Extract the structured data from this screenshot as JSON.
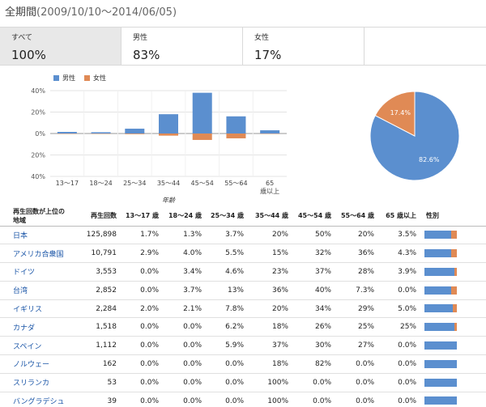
{
  "header": {
    "period_label": "全期間",
    "period_range": "(2009/10/10～2014/06/05)"
  },
  "tabs": [
    {
      "label": "すべて",
      "value": "100%"
    },
    {
      "label": "男性",
      "value": "83%"
    },
    {
      "label": "女性",
      "value": "17%"
    }
  ],
  "colors": {
    "male": "#5b8fcf",
    "female": "#e08a55",
    "tab_active_bg": "#e8e8e8",
    "link": "#1a55a7"
  },
  "chart_data": [
    {
      "type": "bar",
      "title": "",
      "legend": [
        {
          "name": "男性",
          "color": "#5b8fcf"
        },
        {
          "name": "女性",
          "color": "#e08a55"
        }
      ],
      "legend_position": "top-left",
      "xlabel": "年齢",
      "ylabel": "",
      "categories": [
        "13～17",
        "18～24",
        "25～34",
        "35～44",
        "45～54",
        "55～64",
        "65歳以上"
      ],
      "category_lines": [
        [
          "13～17"
        ],
        [
          "18～24"
        ],
        [
          "25～34"
        ],
        [
          "35～44"
        ],
        [
          "45～54"
        ],
        [
          "55～64"
        ],
        [
          "65",
          "歳以上"
        ]
      ],
      "yticks": [
        "40%",
        "20%",
        "0%",
        "20%",
        "40%"
      ],
      "ylim": [
        -40,
        40
      ],
      "grid": true,
      "series": [
        {
          "name": "男性",
          "direction": "up",
          "values": [
            1.5,
            1.2,
            4.5,
            18,
            38,
            16,
            3
          ]
        },
        {
          "name": "女性",
          "direction": "down",
          "values": [
            0.2,
            0.2,
            0.6,
            2,
            6,
            4.5,
            0.3
          ]
        }
      ]
    },
    {
      "type": "pie",
      "title": "",
      "slices": [
        {
          "name": "男性",
          "value": 82.6,
          "label": "82.6%",
          "color": "#5b8fcf"
        },
        {
          "name": "女性",
          "value": 17.4,
          "label": "17.4%",
          "color": "#e08a55"
        }
      ]
    }
  ],
  "table": {
    "headers": {
      "country_line1": "再生回数が上位の",
      "country_line2": "地域",
      "views": "再生回数",
      "a13": "13～17 歳",
      "a18": "18～24 歳",
      "a25": "25～34 歳",
      "a35": "35～44 歳",
      "a45": "45～54 歳",
      "a55": "55～64 歳",
      "a65": "65 歳以上",
      "gender": "性別"
    },
    "rows": [
      {
        "country": "日本",
        "views": "125,898",
        "a13": "1.7%",
        "a18": "1.3%",
        "a25": "3.7%",
        "a35": "20%",
        "a45": "50%",
        "a55": "20%",
        "a65": "3.5%",
        "female_share": 0.17
      },
      {
        "country": "アメリカ合衆国",
        "views": "10,791",
        "a13": "2.9%",
        "a18": "4.0%",
        "a25": "5.5%",
        "a35": "15%",
        "a45": "32%",
        "a55": "36%",
        "a65": "4.3%",
        "female_share": 0.17
      },
      {
        "country": "ドイツ",
        "views": "3,553",
        "a13": "0.0%",
        "a18": "3.4%",
        "a25": "4.6%",
        "a35": "23%",
        "a45": "37%",
        "a55": "28%",
        "a65": "3.9%",
        "female_share": 0.08
      },
      {
        "country": "台湾",
        "views": "2,852",
        "a13": "0.0%",
        "a18": "3.7%",
        "a25": "13%",
        "a35": "36%",
        "a45": "40%",
        "a55": "7.3%",
        "a65": "0.0%",
        "female_share": 0.17
      },
      {
        "country": "イギリス",
        "views": "2,284",
        "a13": "2.0%",
        "a18": "2.1%",
        "a25": "7.8%",
        "a35": "20%",
        "a45": "34%",
        "a55": "29%",
        "a65": "5.0%",
        "female_share": 0.12
      },
      {
        "country": "カナダ",
        "views": "1,518",
        "a13": "0.0%",
        "a18": "0.0%",
        "a25": "6.2%",
        "a35": "18%",
        "a45": "26%",
        "a55": "25%",
        "a65": "25%",
        "female_share": 0.08
      },
      {
        "country": "スペイン",
        "views": "1,112",
        "a13": "0.0%",
        "a18": "0.0%",
        "a25": "5.9%",
        "a35": "37%",
        "a45": "30%",
        "a55": "27%",
        "a65": "0.0%",
        "female_share": 0.0
      },
      {
        "country": "ノルウェー",
        "views": "162",
        "a13": "0.0%",
        "a18": "0.0%",
        "a25": "0.0%",
        "a35": "18%",
        "a45": "82%",
        "a55": "0.0%",
        "a65": "0.0%",
        "female_share": 0.0
      },
      {
        "country": "スリランカ",
        "views": "53",
        "a13": "0.0%",
        "a18": "0.0%",
        "a25": "0.0%",
        "a35": "100%",
        "a45": "0.0%",
        "a55": "0.0%",
        "a65": "0.0%",
        "female_share": 0.0
      },
      {
        "country": "バングラデシュ",
        "views": "39",
        "a13": "0.0%",
        "a18": "0.0%",
        "a25": "0.0%",
        "a35": "100%",
        "a45": "0.0%",
        "a55": "0.0%",
        "a65": "0.0%",
        "female_share": 0.0
      }
    ]
  }
}
